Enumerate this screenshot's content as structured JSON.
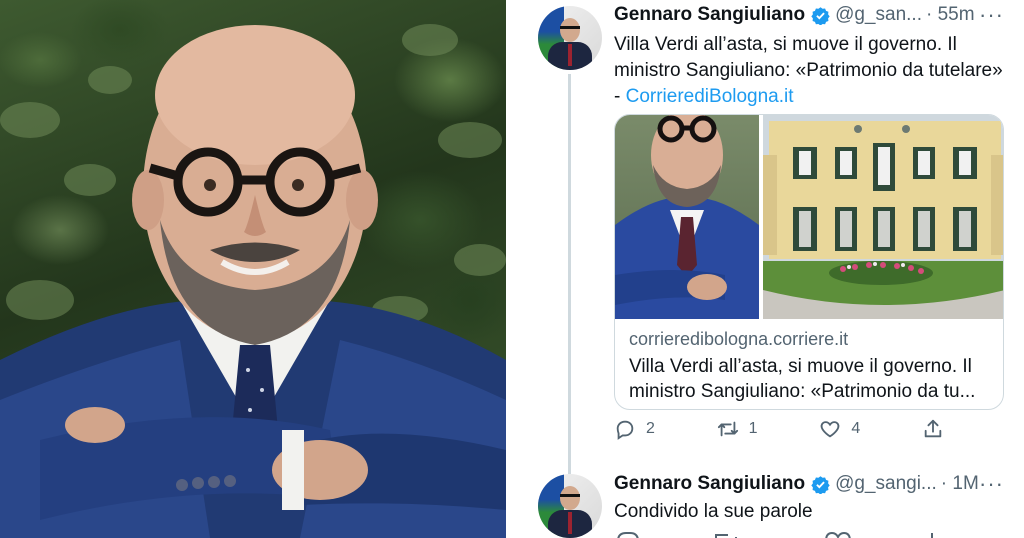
{
  "tweets": [
    {
      "name": "Gennaro Sangiuliano",
      "handle": "@g_san...",
      "time": "· 55m",
      "text_main": "Villa Verdi all’asta, si muove il governo. Il ministro Sangiuliano: «Patrimonio da tutelare» -",
      "text_link": "CorrierediBologna.it",
      "card": {
        "domain": "corrieredibologna.corriere.it",
        "title": "Villa Verdi all’asta, si muove il governo. Il ministro Sangiuliano: «Patrimonio da tu..."
      },
      "actions": {
        "replies": "2",
        "retweets": "1",
        "likes": "4"
      }
    },
    {
      "name": "Gennaro Sangiuliano",
      "handle": "@g_sangi...",
      "time": "· 1M",
      "text_main": "Condivido la sue parole"
    }
  ],
  "colors": {
    "accent": "#1d9bf0",
    "verified": "#1d9bf0",
    "muted": "#536471",
    "text": "#0f1419"
  }
}
